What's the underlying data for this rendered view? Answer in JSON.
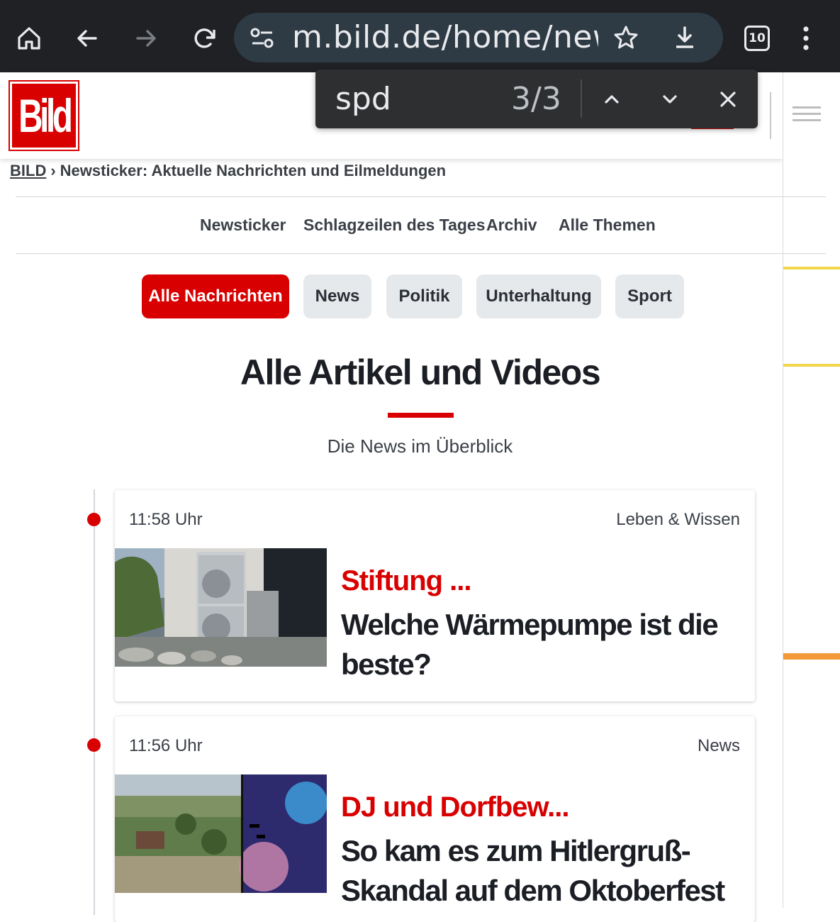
{
  "browser": {
    "url": "m.bild.de/home/new",
    "tab_count": "10",
    "find": {
      "query": "spd",
      "count": "3/3"
    }
  },
  "header": {
    "logo_text": "Bild"
  },
  "breadcrumb": {
    "home": "BILD",
    "separator": "›",
    "current": "Newsticker: Aktuelle Nachrichten und Eilmeldungen"
  },
  "nav": {
    "links": [
      "Newsticker",
      "Schlagzeilen des Tages",
      "Archiv",
      "Alle Themen"
    ]
  },
  "filters": {
    "chips": [
      "Alle Nachrichten",
      "News",
      "Politik",
      "Unterhaltung",
      "Sport"
    ],
    "active": "Alle Nachrichten"
  },
  "section": {
    "title": "Alle Artikel und Videos",
    "subtitle": "Die News im Überblick"
  },
  "articles": [
    {
      "time": "11:58 Uhr",
      "category": "Leben & Wissen",
      "kicker": "Stiftung ...",
      "headline": "Welche Wärmepumpe ist die beste?"
    },
    {
      "time": "11:56 Uhr",
      "category": "News",
      "kicker": "DJ und Dorfbew...",
      "headline": "So kam es zum Hitlergruß-Skandal auf dem Oktoberfest"
    }
  ],
  "colors": {
    "brand_red": "#d80000",
    "chrome_bg": "#1f2124",
    "scroll_highlight": "#f2d64b",
    "scroll_current": "#f29a38"
  }
}
